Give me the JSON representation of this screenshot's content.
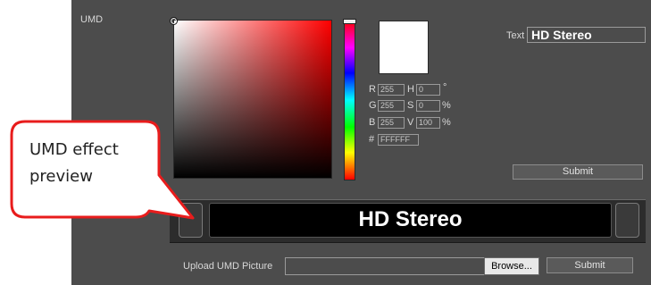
{
  "section": {
    "label": "UMD"
  },
  "color_picker": {
    "r_label": "R",
    "r_value": "255",
    "g_label": "G",
    "g_value": "255",
    "b_label": "B",
    "b_value": "255",
    "h_label": "H",
    "h_value": "0",
    "h_unit": "°",
    "s_label": "S",
    "s_value": "0",
    "s_unit": "%",
    "v_label": "V",
    "v_value": "100",
    "v_unit": "%",
    "hex_label": "#",
    "hex_value": "FFFFFF",
    "swatch_color": "#ffffff"
  },
  "text_field": {
    "label": "Text",
    "value": "HD Stereo"
  },
  "buttons": {
    "submit_top": "Submit",
    "submit_bottom": "Submit",
    "browse": "Browse..."
  },
  "preview": {
    "text": "HD Stereo"
  },
  "upload": {
    "label": "Upload UMD Picture",
    "value": ""
  },
  "callout": {
    "line1": "UMD effect",
    "line2": "preview",
    "border_color": "#e81c1c"
  },
  "colors": {
    "panel_bg": "#4c4c4c",
    "preview_bg": "#000000"
  }
}
